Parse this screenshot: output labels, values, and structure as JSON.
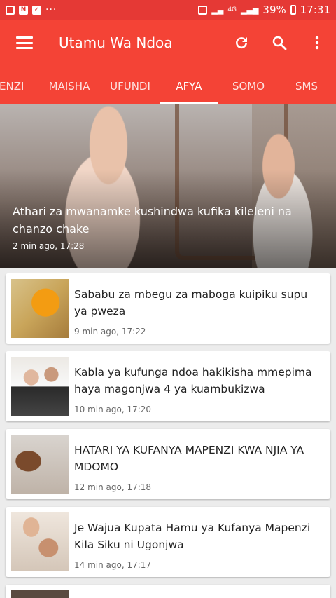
{
  "status_bar": {
    "left_icons": [
      "gallery-icon",
      "n-icon",
      "check-icon",
      "more-icon"
    ],
    "network": "4G",
    "battery": "39%",
    "time": "17:31"
  },
  "app_bar": {
    "title": "Utamu Wa Ndoa"
  },
  "tabs": [
    {
      "label": "PENZI"
    },
    {
      "label": "MAISHA"
    },
    {
      "label": "UFUNDI"
    },
    {
      "label": "AFYA",
      "active": true
    },
    {
      "label": "SOMO"
    },
    {
      "label": "SMS"
    }
  ],
  "featured": {
    "title": "Athari za mwanamke kushindwa kufika kileleni na chanzo chake",
    "time": "2 min ago, 17:28"
  },
  "articles": [
    {
      "title": "Sababu za mbegu za maboga kuipiku supu ya pweza",
      "time": "9 min ago, 17:22"
    },
    {
      "title": "Kabla ya kufunga ndoa hakikisha mmepima haya magonjwa 4 ya kuambukizwa",
      "time": "10 min ago, 17:20"
    },
    {
      "title": "HATARI YA KUFANYA MAPENZI KWA NJIA YA MDOMO",
      "time": "12 min ago, 17:18"
    },
    {
      "title": "Je Wajua Kupata Hamu ya Kufanya Mapenzi Kila Siku ni Ugonjwa",
      "time": "14 min ago, 17:17"
    }
  ],
  "colors": {
    "primary": "#f44336",
    "status_bar": "#e53935",
    "background": "#ececec"
  }
}
